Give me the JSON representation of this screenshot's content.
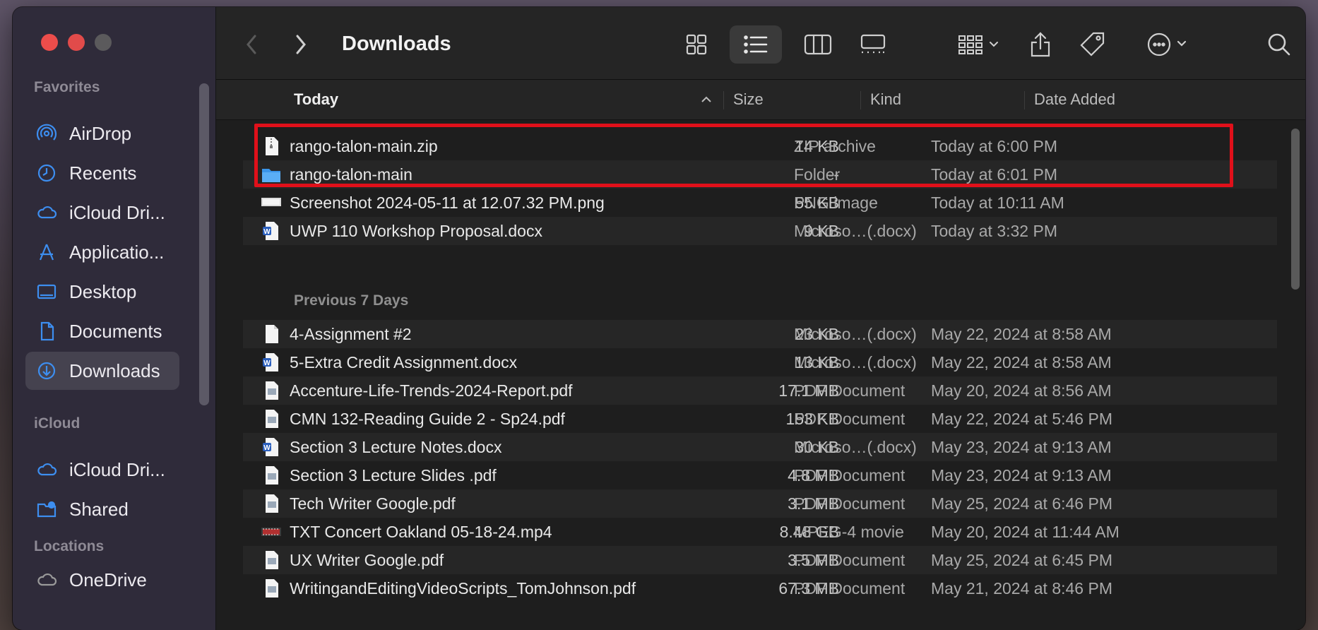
{
  "window": {
    "title": "Downloads"
  },
  "sidebar": {
    "sections": [
      {
        "label": "Favorites",
        "items": [
          {
            "label": "AirDrop",
            "icon": "airdrop-icon"
          },
          {
            "label": "Recents",
            "icon": "clock-icon"
          },
          {
            "label": "iCloud Dri...",
            "icon": "cloud-icon"
          },
          {
            "label": "Applicatio...",
            "icon": "applications-icon"
          },
          {
            "label": "Desktop",
            "icon": "desktop-icon"
          },
          {
            "label": "Documents",
            "icon": "document-icon"
          },
          {
            "label": "Downloads",
            "icon": "downloads-icon",
            "selected": true
          }
        ]
      },
      {
        "label": "iCloud",
        "items": [
          {
            "label": "iCloud Dri...",
            "icon": "cloud-icon"
          },
          {
            "label": "Shared",
            "icon": "shared-folder-icon"
          }
        ]
      },
      {
        "label": "Locations",
        "items": [
          {
            "label": "OneDrive",
            "icon": "cloud-icon"
          }
        ]
      }
    ]
  },
  "columns": {
    "name": "Today",
    "size": "Size",
    "kind": "Kind",
    "date": "Date Added"
  },
  "groups": {
    "previous_title": "Previous 7 Days"
  },
  "today_files": [
    {
      "name": "rango-talon-main.zip",
      "size": "14 KB",
      "kind": "ZIP archive",
      "date": "Today at 6:00 PM",
      "icon": "zip-icon"
    },
    {
      "name": "rango-talon-main",
      "size": "--",
      "kind": "Folder",
      "date": "Today at 6:01 PM",
      "icon": "folder-icon"
    },
    {
      "name": "Screenshot 2024-05-11 at 12.07.32 PM.png",
      "size": "55 KB",
      "kind": "PNG image",
      "date": "Today at 10:11 AM",
      "icon": "image-icon"
    },
    {
      "name": "UWP 110 Workshop Proposal.docx",
      "size": "9 KB",
      "kind": "Microso…(.docx)",
      "date": "Today at 3:32 PM",
      "icon": "word-icon"
    }
  ],
  "previous_files": [
    {
      "name": "4-Assignment #2",
      "size": "23 KB",
      "kind": "Microso…(.docx)",
      "date": "May 22, 2024 at 8:58 AM",
      "icon": "blank-doc-icon"
    },
    {
      "name": "5-Extra Credit Assignment.docx",
      "size": "13 KB",
      "kind": "Microso…(.docx)",
      "date": "May 22, 2024 at 8:58 AM",
      "icon": "word-icon"
    },
    {
      "name": "Accenture-Life-Trends-2024-Report.pdf",
      "size": "17.1 MB",
      "kind": "PDF Document",
      "date": "May 20, 2024 at 8:56 AM",
      "icon": "pdf-icon"
    },
    {
      "name": "CMN 132-Reading Guide 2 - Sp24.pdf",
      "size": "153 KB",
      "kind": "PDF Document",
      "date": "May 22, 2024 at 5:46 PM",
      "icon": "pdf-icon"
    },
    {
      "name": "Section 3 Lecture Notes.docx",
      "size": "30 KB",
      "kind": "Microso…(.docx)",
      "date": "May 23, 2024 at 9:13 AM",
      "icon": "word-icon"
    },
    {
      "name": "Section 3 Lecture Slides .pdf",
      "size": "4.8 MB",
      "kind": "PDF Document",
      "date": "May 23, 2024 at 9:13 AM",
      "icon": "pdf-icon"
    },
    {
      "name": "Tech Writer Google.pdf",
      "size": "3.1 MB",
      "kind": "PDF Document",
      "date": "May 25, 2024 at 6:46 PM",
      "icon": "pdf-icon"
    },
    {
      "name": "TXT Concert Oakland 05-18-24.mp4",
      "size": "8.48 GB",
      "kind": "MPEG-4 movie",
      "date": "May 20, 2024 at 11:44 AM",
      "icon": "video-icon"
    },
    {
      "name": "UX Writer Google.pdf",
      "size": "3.5 MB",
      "kind": "PDF Document",
      "date": "May 25, 2024 at 6:45 PM",
      "icon": "pdf-icon"
    },
    {
      "name": "WritingandEditingVideoScripts_TomJohnson.pdf",
      "size": "67.3 MB",
      "kind": "PDF Document",
      "date": "May 21, 2024 at 8:46 PM",
      "icon": "pdf-icon"
    }
  ],
  "colors": {
    "accent": "#0a84ff",
    "highlight_box": "#e0101a",
    "close": "#ec4d4b"
  }
}
